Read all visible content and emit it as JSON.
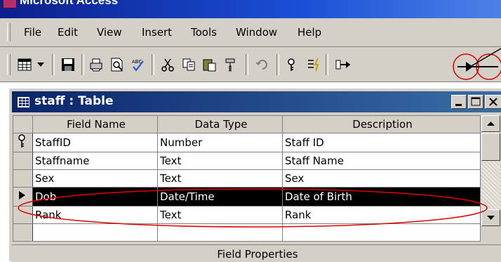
{
  "app": {
    "title": "Microsoft Access"
  },
  "menu": [
    "File",
    "Edit",
    "View",
    "Insert",
    "Tools",
    "Window",
    "Help"
  ],
  "toolbar": {
    "buttons": [
      "table-view-icon",
      "dropdown-arrow-icon",
      "save-icon",
      "print-icon",
      "print-preview-icon",
      "spelling-icon",
      "cut-icon",
      "copy-icon",
      "paste-icon",
      "format-painter-icon",
      "undo-icon",
      "primary-key-icon",
      "build-icon",
      "relationship-icon"
    ]
  },
  "table_window": {
    "title": "staff : Table",
    "columns": [
      "Field Name",
      "Data Type",
      "Description"
    ],
    "rows": [
      {
        "field": "StaffID",
        "type": "Number",
        "description": "Staff ID",
        "key": true,
        "current": false
      },
      {
        "field": "Staffname",
        "type": "Text",
        "description": "Staff Name",
        "key": false,
        "current": false
      },
      {
        "field": "Sex",
        "type": "Text",
        "description": "Sex",
        "key": false,
        "current": false
      },
      {
        "field": "Dob",
        "type": "Date/Time",
        "description": "Date of Birth",
        "key": false,
        "current": true
      },
      {
        "field": "Rank",
        "type": "Text",
        "description": "Rank",
        "key": false,
        "current": false
      },
      {
        "field": "",
        "type": "",
        "description": "",
        "key": false,
        "current": false
      }
    ],
    "field_properties_label": "Field Properties"
  },
  "annotation_color": "#e00000"
}
